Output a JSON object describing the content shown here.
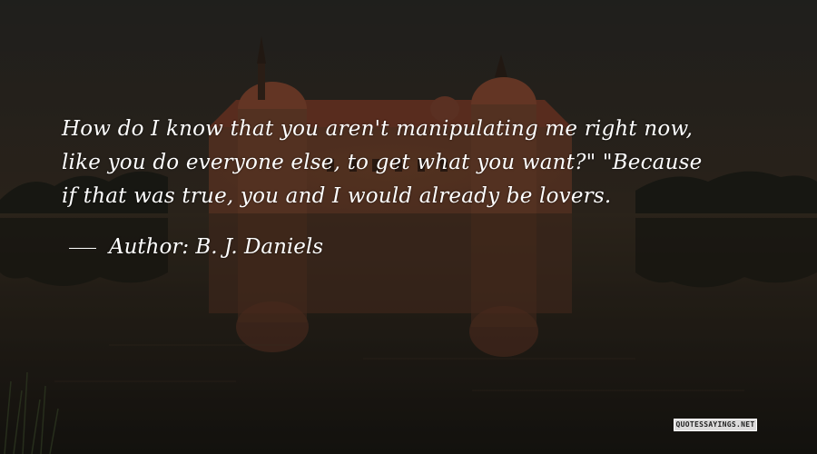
{
  "quote": {
    "lines": [
      "How do I know that you aren't manipulating me right now,",
      "like you do everyone else, to get what you want?\" \"Because",
      "if that was true, you and I would already be lovers."
    ]
  },
  "author": {
    "label": "Author:",
    "name": "B. J. Daniels"
  },
  "watermark": {
    "text": "QUOTESSAYINGS.NET"
  }
}
